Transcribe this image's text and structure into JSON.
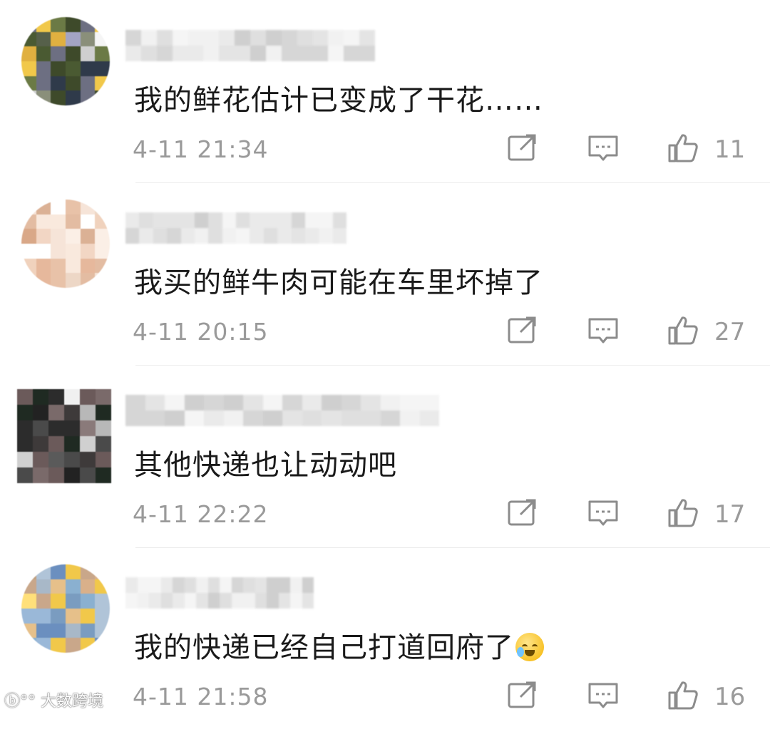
{
  "comments": [
    {
      "text": "我的鲜花估计已变成了干花……",
      "time": "4-11 21:34",
      "likes": "11",
      "emoji": false
    },
    {
      "text": "我买的鲜牛肉可能在车里坏掉了",
      "time": "4-11 20:15",
      "likes": "27",
      "emoji": false
    },
    {
      "text": "其他快递也让动动吧",
      "time": "4-11 22:22",
      "likes": "17",
      "emoji": false
    },
    {
      "text": "我的快递已经自己打道回府了",
      "time": "4-11 21:58",
      "likes": "16",
      "emoji": true
    }
  ],
  "icons": {
    "share": "share-icon",
    "reply": "comment-icon",
    "like": "thumbs-up-icon"
  },
  "watermark": "大数跨境",
  "colors": {
    "text": "#1a1a1a",
    "meta": "#9a9a9a",
    "divider": "#ececec",
    "background": "#ffffff"
  }
}
